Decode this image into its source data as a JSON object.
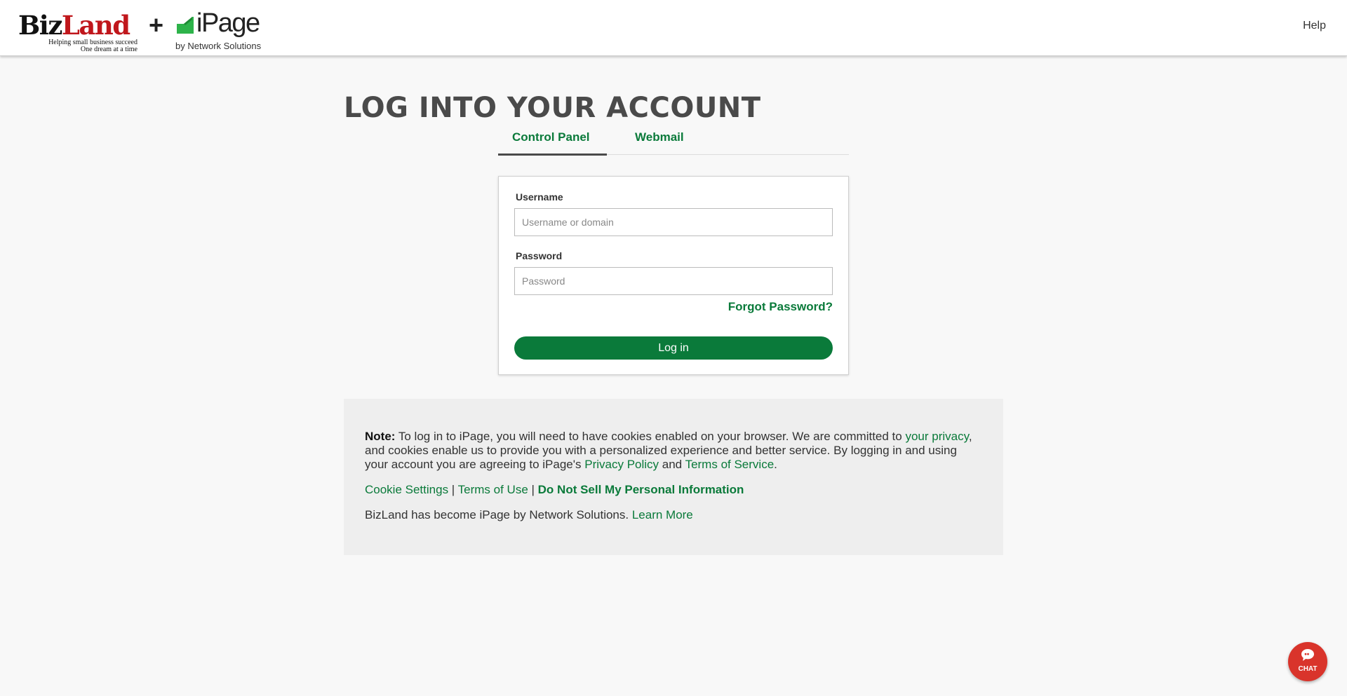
{
  "header": {
    "bizland_logo": {
      "brand_part1": "Biz",
      "brand_part2": "Land",
      "tagline_line1": "Helping small business succeed",
      "tagline_line2": "One dream at a time"
    },
    "plus": "+",
    "ipage_logo": {
      "brand": "iPage",
      "byline": "by Network Solutions"
    },
    "help_label": "Help"
  },
  "page_title": "LOG INTO YOUR ACCOUNT",
  "tabs": [
    {
      "label": "Control Panel",
      "active": true
    },
    {
      "label": "Webmail",
      "active": false
    }
  ],
  "login_form": {
    "username_label": "Username",
    "username_placeholder": "Username or domain",
    "username_value": "",
    "password_label": "Password",
    "password_placeholder": "Password",
    "password_value": "",
    "forgot_label": "Forgot Password?",
    "login_button": "Log in"
  },
  "note": {
    "lead": "Note:",
    "text1": " To log in to iPage, you will need to have cookies enabled on your browser. We are committed to ",
    "link_privacy": "your privacy",
    "text2": ", and cookies enable us to provide you with a personalized experience and better service. By logging in and using your account you are agreeing to iPage's ",
    "link_privacy_policy": "Privacy Policy",
    "text3": " and ",
    "link_terms": "Terms of Service",
    "text4": "."
  },
  "footer_links": {
    "cookie_settings": "Cookie Settings",
    "sep1": " | ",
    "terms_of_use": "Terms of Use",
    "sep2": " | ",
    "do_not_sell": "Do Not Sell My Personal Information"
  },
  "merge_notice": {
    "text": "BizLand has become iPage by Network Solutions. ",
    "learn_more": "Learn More"
  },
  "chat": {
    "label": "CHAT"
  },
  "colors": {
    "brand_green": "#0a7a3a",
    "bizland_red": "#c0171c",
    "ipage_green": "#2db34a",
    "chat_red": "#d9342b"
  }
}
